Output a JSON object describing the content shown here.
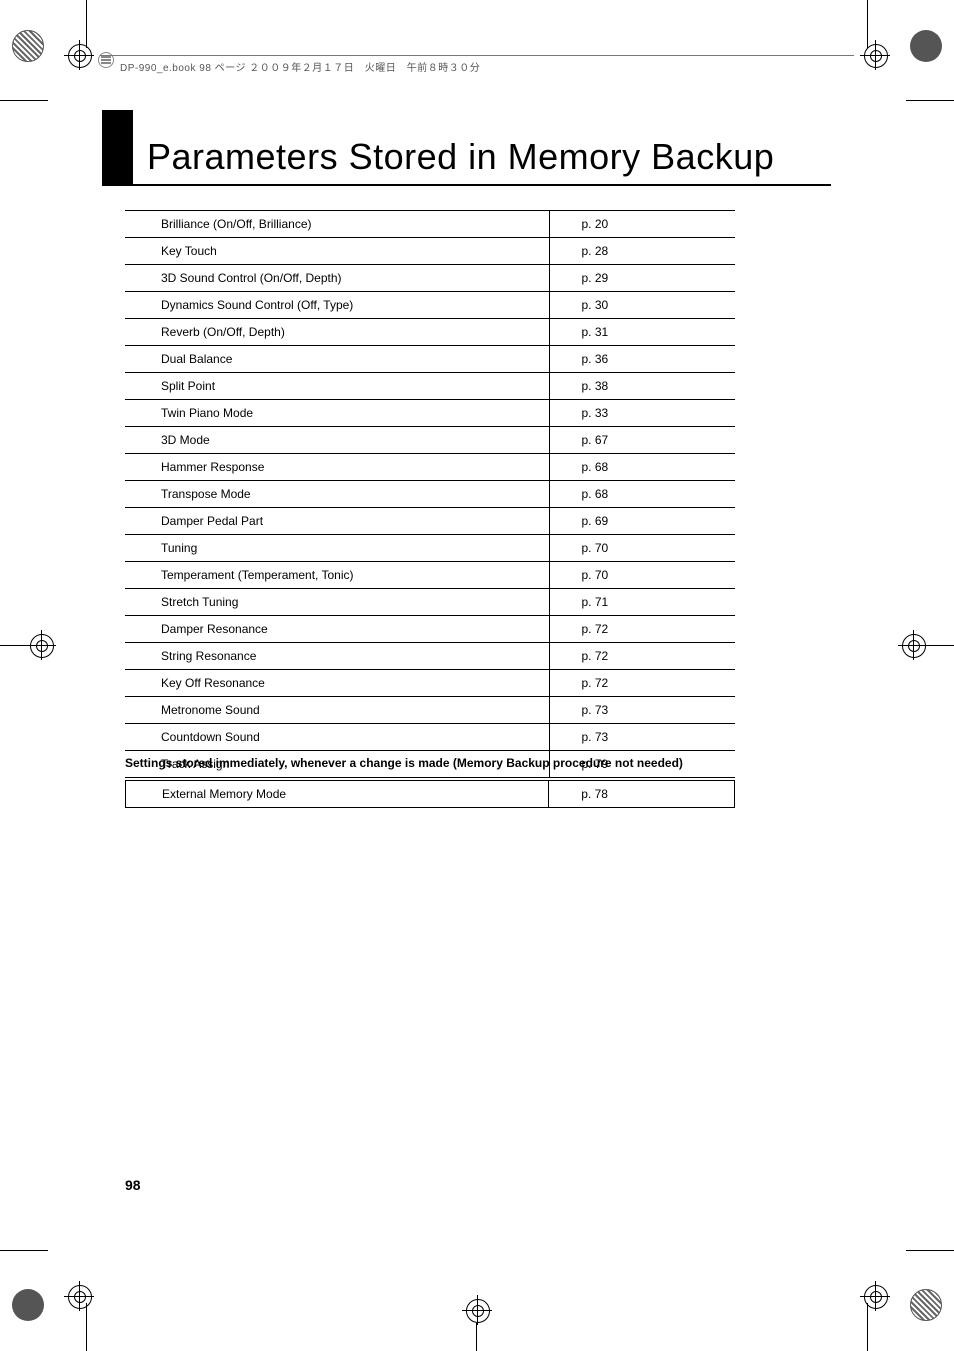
{
  "header": {
    "text": "DP-990_e.book  98 ページ  ２００９年２月１７日　火曜日　午前８時３０分"
  },
  "title": "Parameters Stored in Memory Backup",
  "table": [
    {
      "param": "Brilliance (On/Off, Brilliance)",
      "page": "p. 20"
    },
    {
      "param": "Key Touch",
      "page": "p. 28"
    },
    {
      "param": "3D Sound Control (On/Off, Depth)",
      "page": "p. 29"
    },
    {
      "param": "Dynamics Sound Control (Off, Type)",
      "page": "p. 30"
    },
    {
      "param": "Reverb (On/Off, Depth)",
      "page": "p. 31"
    },
    {
      "param": "Dual Balance",
      "page": "p. 36"
    },
    {
      "param": "Split Point",
      "page": "p. 38"
    },
    {
      "param": "Twin Piano Mode",
      "page": "p. 33"
    },
    {
      "param": "3D Mode",
      "page": "p. 67"
    },
    {
      "param": "Hammer Response",
      "page": "p. 68"
    },
    {
      "param": "Transpose Mode",
      "page": "p. 68"
    },
    {
      "param": "Damper Pedal Part",
      "page": "p. 69"
    },
    {
      "param": "Tuning",
      "page": "p. 70"
    },
    {
      "param": "Temperament (Temperament, Tonic)",
      "page": "p. 70"
    },
    {
      "param": "Stretch Tuning",
      "page": "p. 71"
    },
    {
      "param": "Damper Resonance",
      "page": "p. 72"
    },
    {
      "param": "String Resonance",
      "page": "p. 72"
    },
    {
      "param": "Key Off Resonance",
      "page": "p. 72"
    },
    {
      "param": "Metronome Sound",
      "page": "p. 73"
    },
    {
      "param": "Countdown Sound",
      "page": "p. 73"
    },
    {
      "param": "Track Assign",
      "page": "p. 79"
    }
  ],
  "subheading": "Settings stored immediately, whenever a change is made (Memory Backup procedure not needed)",
  "table2": [
    {
      "param": "External Memory Mode",
      "page": "p. 78"
    }
  ],
  "page_number": "98"
}
